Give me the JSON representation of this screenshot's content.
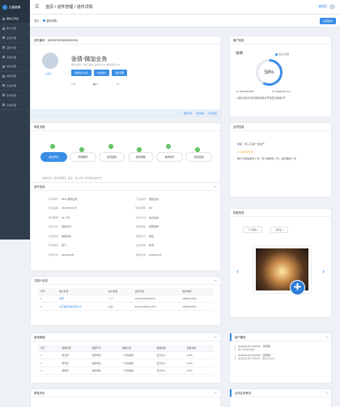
{
  "app": {
    "logo": "云融钢服"
  },
  "sidebar": {
    "items": [
      {
        "label": "我的工作台",
        "active": true
      },
      {
        "label": "客户管理"
      },
      {
        "label": "业务管理"
      },
      {
        "label": "进件管理"
      },
      {
        "label": "风控管理"
      },
      {
        "label": "财务管理"
      },
      {
        "label": "档案管理"
      },
      {
        "label": "贷后管理"
      },
      {
        "label": "系统管理"
      },
      {
        "label": "日常管理"
      }
    ]
  },
  "topbar": {
    "breadcrumb": "首页 / 进件管理 / 进件详情",
    "user": "管理员"
  },
  "tabs": [
    {
      "label": "首页"
    },
    {
      "label": "进件详情"
    }
  ],
  "tab_action": "关闭操作",
  "detail": {
    "id_label": "进件编号：MGHSFM201806250001",
    "name": "张倩-微加业务",
    "sub": "主办员",
    "info1": "客户名称 个体工商户  业务员 XX  录件时间 XX",
    "btns": [
      "新增客户信息",
      "补充资料",
      "查看流程"
    ],
    "stats": [
      {
        "label": "0",
        "icon": "待办"
      },
      {
        "label": "0",
        "icon": "已办"
      },
      {
        "label": "0",
        "icon": "退回"
      }
    ],
    "footer": [
      "撤回审核",
      "退回审核",
      "同意审核"
    ]
  },
  "customer": {
    "title": "客户信息",
    "name": "张倩",
    "tag": "信用无问题",
    "percent": "58%",
    "phone": "18621201643",
    "email": "zhq@163.com",
    "address": "湖北省武汉市东湖高新技术开发区光谷路1号"
  },
  "flow": {
    "title": "审批流程",
    "steps": [
      "提交申请",
      "风控审核",
      "合同签约",
      "放款审批",
      "放款执行",
      "贷款完成"
    ],
    "note": "进件状态 【风控审核】 备注：本人/家人某/风控/业务/员"
  },
  "loan": {
    "title": "进件信息",
    "rows": [
      [
        "申请编号",
        "MG1-借款业务",
        "产品名称",
        "微加业务"
      ],
      [
        "申请金额",
        "200,000.00 元",
        "利率/期限",
        "8%"
      ],
      [
        "申请期限",
        "12 个月",
        "还款方式",
        "先息后本"
      ],
      [
        "放款方式",
        "受托支付",
        "借款用途",
        "经营周转"
      ],
      [
        "贷款类型",
        "信用贷款",
        "担保方式",
        "保证"
      ],
      [
        "申请渠道",
        "线下",
        "业务类型",
        "新增"
      ],
      [
        "申请时间",
        "2018-06-25",
        "审批时间",
        "2018-06-26"
      ]
    ]
  },
  "borrowers": {
    "title": "共借人信息",
    "cols": [
      "序号",
      "客户名称",
      "客户类型",
      "证件号码",
      "联系电话"
    ],
    "rows": [
      [
        "1",
        "倪明",
        "个人",
        "4201020108210440",
        "18600010008"
      ],
      [
        "2",
        "北京菁星科技有限公司",
        "企业",
        "91420115MA4L2XXX",
        "18678070023"
      ]
    ]
  },
  "fees": {
    "title": "费用明细",
    "cols": [
      "序号",
      "费用名称",
      "收取环节",
      "收取方式",
      "费用标准",
      "费用金额"
    ],
    "rows": [
      [
        "1",
        "综合费",
        "放款审核",
        "一次性收取",
        "百分比%",
        "10.00"
      ],
      [
        "2",
        "服务费",
        "放款审核",
        "一次性收取",
        "百分比%",
        "10.00"
      ],
      [
        "3",
        "其他费",
        "放款审核",
        "一次性收取",
        "百分比%",
        "10.00"
      ]
    ]
  },
  "history": {
    "title": "审批历史"
  },
  "rep": {
    "title": "自然信息",
    "line1": "担保：张三/东湖一街资产",
    "amount": "¥ 100.00万元",
    "line3": "客户已授信审批 1 件，待人审审批 1 件，放款审批 0 件"
  },
  "archive": {
    "title": "档案信息",
    "selects": [
      "个人资料",
      "身份证"
    ]
  },
  "follow": {
    "title": "客户跟进",
    "entries": [
      {
        "time": "2018-06-25 10:00:00",
        "who": "张晓丽",
        "text": "客户有借款需求"
      },
      {
        "time": "2018-06-26 10:00:00",
        "who": "张晓丽",
        "text": "电话回访客户有意向，需先息后本"
      }
    ]
  },
  "biz": {
    "title": "业务往来情况"
  },
  "colors": {
    "accent": "#3a8ee6",
    "sidebar": "#2f3d4c",
    "green": "#5cbf5c"
  }
}
